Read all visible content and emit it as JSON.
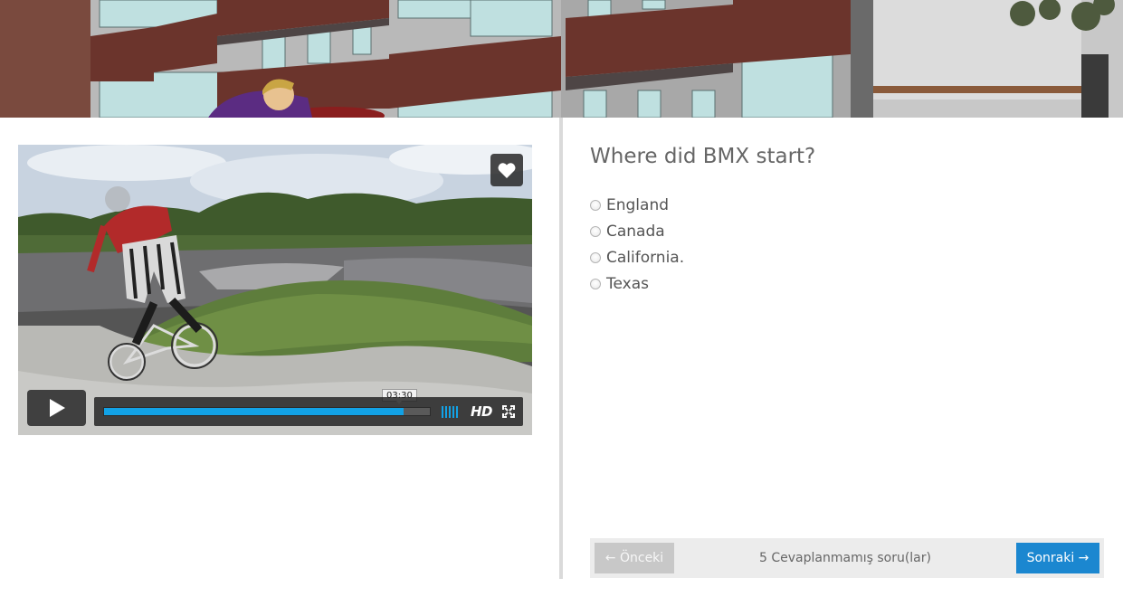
{
  "video": {
    "time_tooltip": "03:30",
    "progress": 0.92,
    "hd_label": "HD",
    "icons": {
      "like": "heart-icon",
      "play": "play-icon",
      "fullscreen": "fullscreen-icon",
      "volume": "volume-bars-icon"
    },
    "accent_color": "#12a2e6"
  },
  "quiz": {
    "question": "Where did BMX start?",
    "options": [
      {
        "label": "England"
      },
      {
        "label": "Canada"
      },
      {
        "label": "California."
      },
      {
        "label": "Texas"
      }
    ],
    "footer": {
      "prev_label": "← Önceki",
      "status": "5 Cevaplanmamış soru(lar)",
      "next_label": "Sonraki →"
    },
    "colors": {
      "next_button": "#1b87d0",
      "prev_button_disabled": "#c8c8c8"
    }
  }
}
